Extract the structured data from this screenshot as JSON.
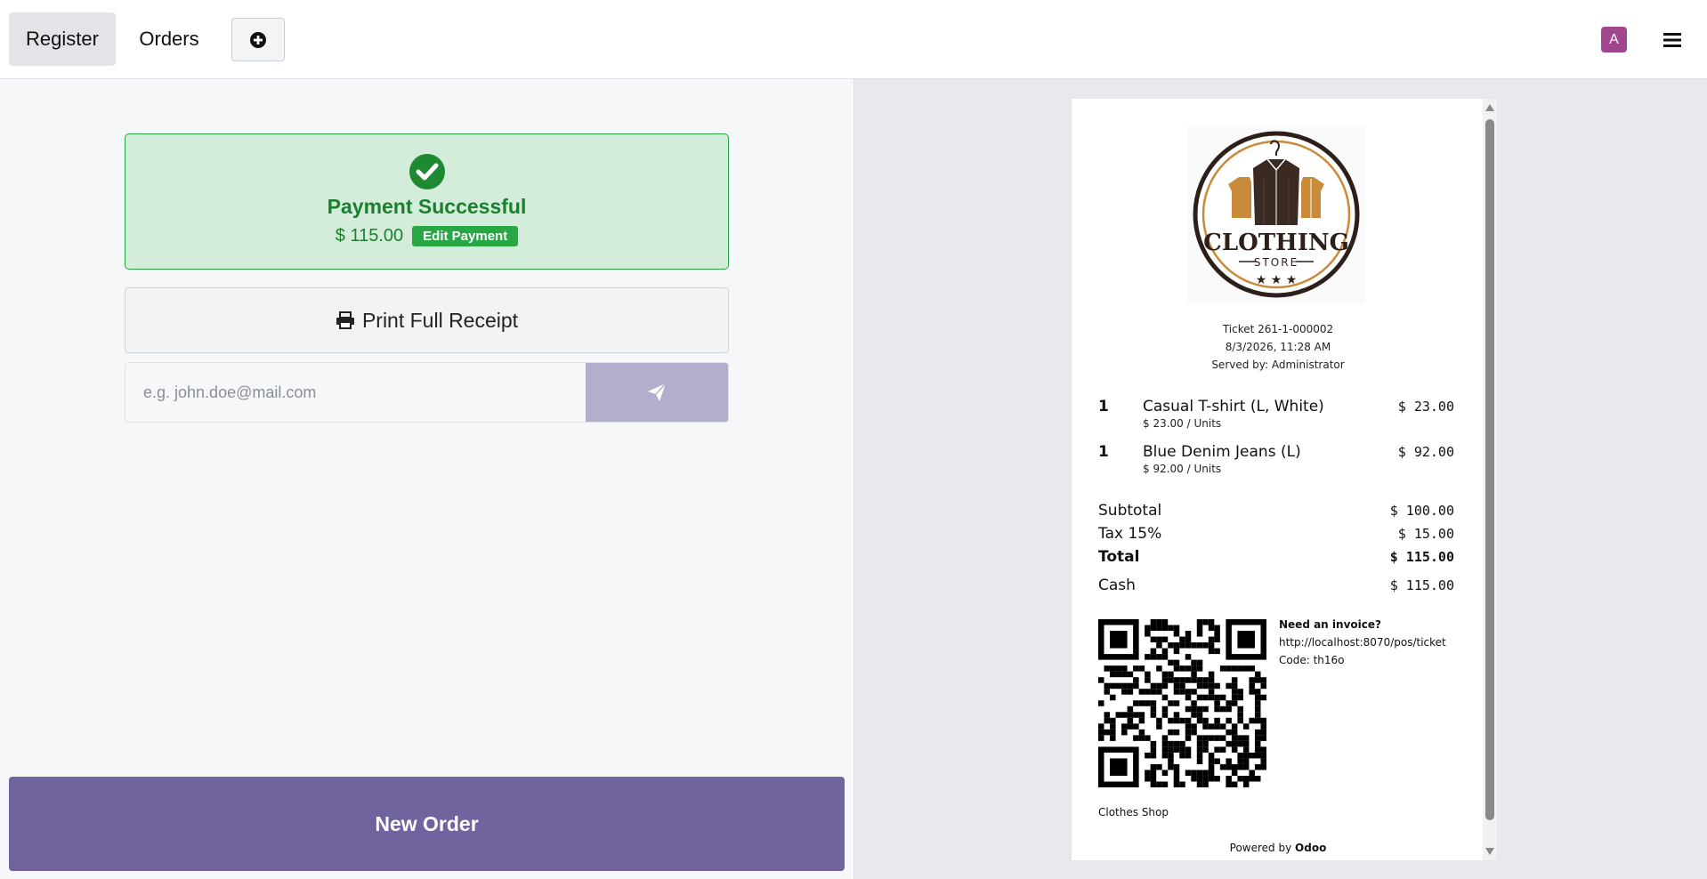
{
  "topbar": {
    "tab_register": "Register",
    "tab_orders": "Orders",
    "add_icon": "plus-circle-icon",
    "avatar_letter": "A",
    "avatar_color": "#a2458f",
    "menu_icon": "hamburger-menu-icon"
  },
  "payment": {
    "icon": "check-circle-icon",
    "title": "Payment Successful",
    "amount": "$ 115.00",
    "edit_label": "Edit Payment",
    "color": "#28a745"
  },
  "print": {
    "icon": "printer-icon",
    "label": "Print Full Receipt"
  },
  "email": {
    "placeholder": "e.g. john.doe@mail.com",
    "value": "",
    "send_icon": "paper-plane-icon"
  },
  "new_order_label": "New Order",
  "receipt": {
    "logo": {
      "text": "CLOTHING",
      "subtext": "STORE"
    },
    "ticket": "Ticket 261-1-000002",
    "date": "8/3/2026, 11:28 AM",
    "served_by": "Served by: Administrator",
    "lines": [
      {
        "qty": "1",
        "name": "Casual T-shirt (L, White)",
        "unit": "$ 23.00 / Units",
        "price": "$ 23.00"
      },
      {
        "qty": "1",
        "name": "Blue Denim Jeans (L)",
        "unit": "$ 92.00 / Units",
        "price": "$ 92.00"
      }
    ],
    "subtotal_label": "Subtotal",
    "subtotal": "$ 100.00",
    "tax_label": "Tax 15%",
    "tax": "$ 15.00",
    "total_label": "Total",
    "total": "$ 115.00",
    "cash_label": "Cash",
    "cash": "$ 115.00",
    "invoice_title": "Need an invoice?",
    "invoice_url": "http://localhost:8070/pos/ticket",
    "invoice_code": "Code: th16o",
    "shop_name": "Clothes Shop",
    "powered_by": "Powered by",
    "powered_brand": "Odoo"
  }
}
